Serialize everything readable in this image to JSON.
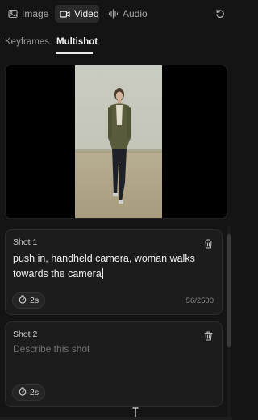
{
  "mode_tabs": [
    {
      "label": "Image",
      "icon": "image-icon"
    },
    {
      "label": "Video",
      "icon": "video-camera-icon"
    },
    {
      "label": "Audio",
      "icon": "audio-wave-icon"
    }
  ],
  "active_mode": "Video",
  "sub_tabs": [
    {
      "label": "Keyframes"
    },
    {
      "label": "Multishot"
    }
  ],
  "active_sub_tab": "Multishot",
  "preview": {
    "subject": "woman-walking-video-frame"
  },
  "shots": [
    {
      "title": "Shot 1",
      "prompt": "push in, handheld camera, woman walks towards the camera",
      "placeholder": "Describe this shot",
      "duration": "2s",
      "char_count": "56/2500"
    },
    {
      "title": "Shot 2",
      "prompt": "",
      "placeholder": "Describe this shot",
      "duration": "2s"
    }
  ],
  "colors": {
    "background": "#141414",
    "card": "#1c1c1c",
    "active_tab": "#2a2a2a",
    "accent_text": "#f2f2f2"
  }
}
